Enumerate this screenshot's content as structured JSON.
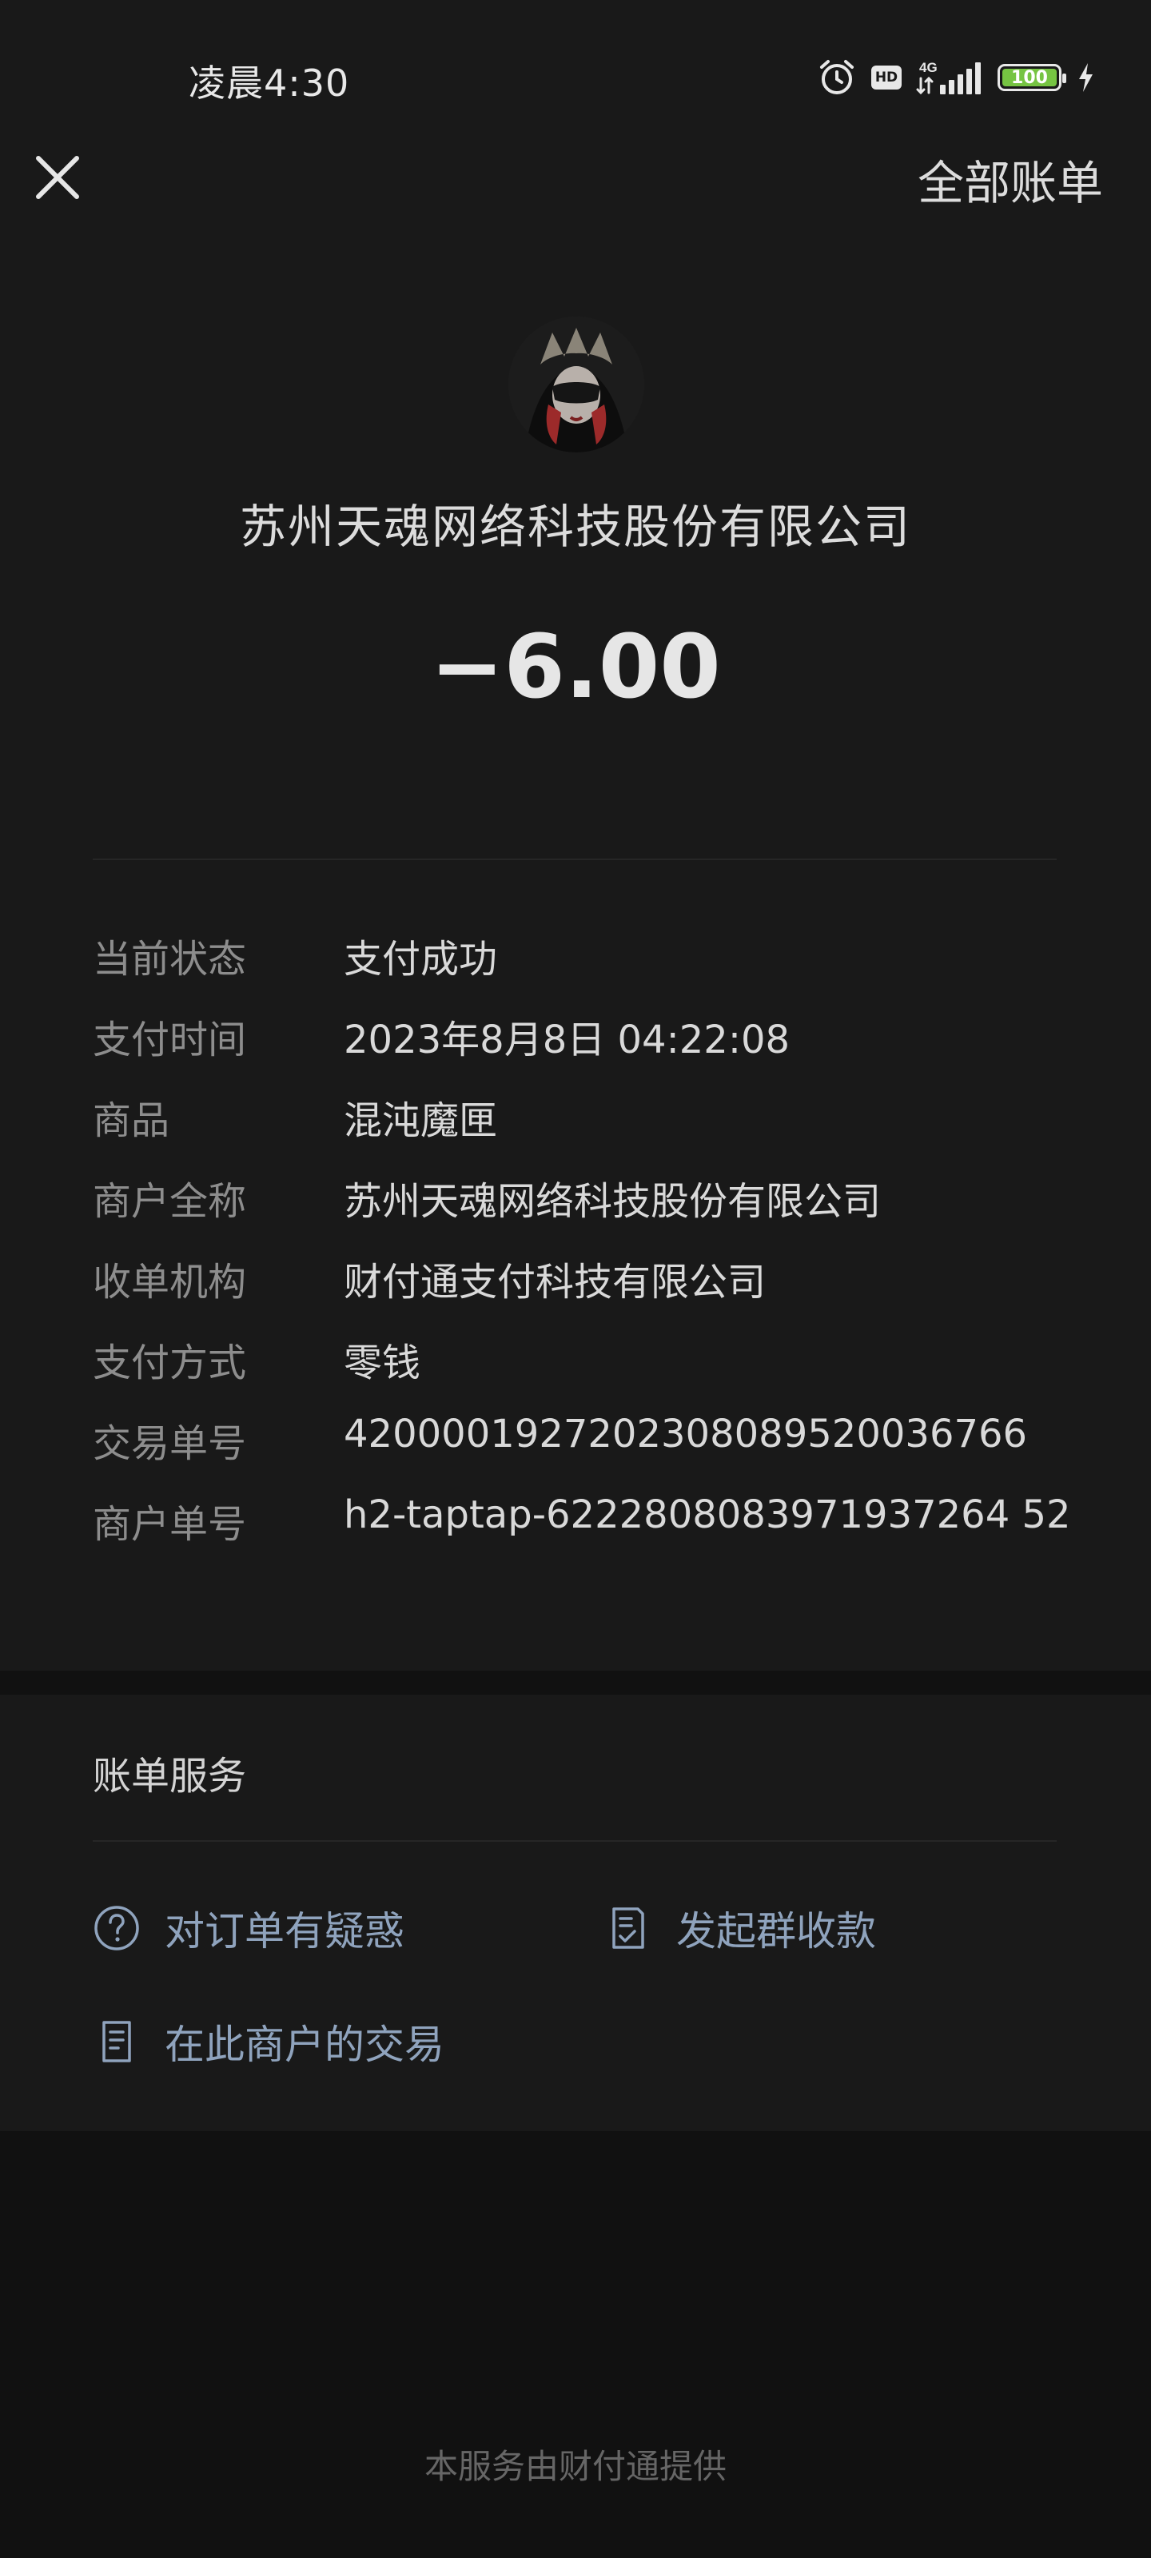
{
  "status_bar": {
    "time": "凌晨4:30",
    "hd_label": "HD",
    "network_label": "4G",
    "battery_level": "100",
    "icons": [
      "alarm-icon",
      "hd-icon",
      "signal-icon",
      "battery-icon",
      "charging-icon"
    ]
  },
  "header": {
    "close_icon": "close-icon",
    "all_bills_label": "全部账单"
  },
  "summary": {
    "merchant_name": "苏州天魂网络科技股份有限公司",
    "amount": "−6.00"
  },
  "details": [
    {
      "label": "当前状态",
      "value": "支付成功"
    },
    {
      "label": "支付时间",
      "value": "2023年8月8日 04:22:08"
    },
    {
      "label": "商品",
      "value": "混沌魔匣"
    },
    {
      "label": "商户全称",
      "value": "苏州天魂网络科技股份有限公司"
    },
    {
      "label": "收单机构",
      "value": "财付通支付科技有限公司"
    },
    {
      "label": "支付方式",
      "value": "零钱"
    },
    {
      "label": "交易单号",
      "value": "4200001927202308089520036766"
    },
    {
      "label": "商户单号",
      "value": "h2-taptap-6222808083971937264 52"
    }
  ],
  "services": {
    "title": "账单服务",
    "items": [
      {
        "label": "对订单有疑惑",
        "icon": "question-circle-icon"
      },
      {
        "label": "发起群收款",
        "icon": "checklist-icon"
      },
      {
        "label": "在此商户的交易",
        "icon": "document-icon"
      }
    ]
  },
  "footer": {
    "note": "本服务由财付通提供"
  },
  "colors": {
    "background": "#111111",
    "card": "#191919",
    "service_link": "#8fa3bd",
    "battery_fill": "#76c442"
  }
}
